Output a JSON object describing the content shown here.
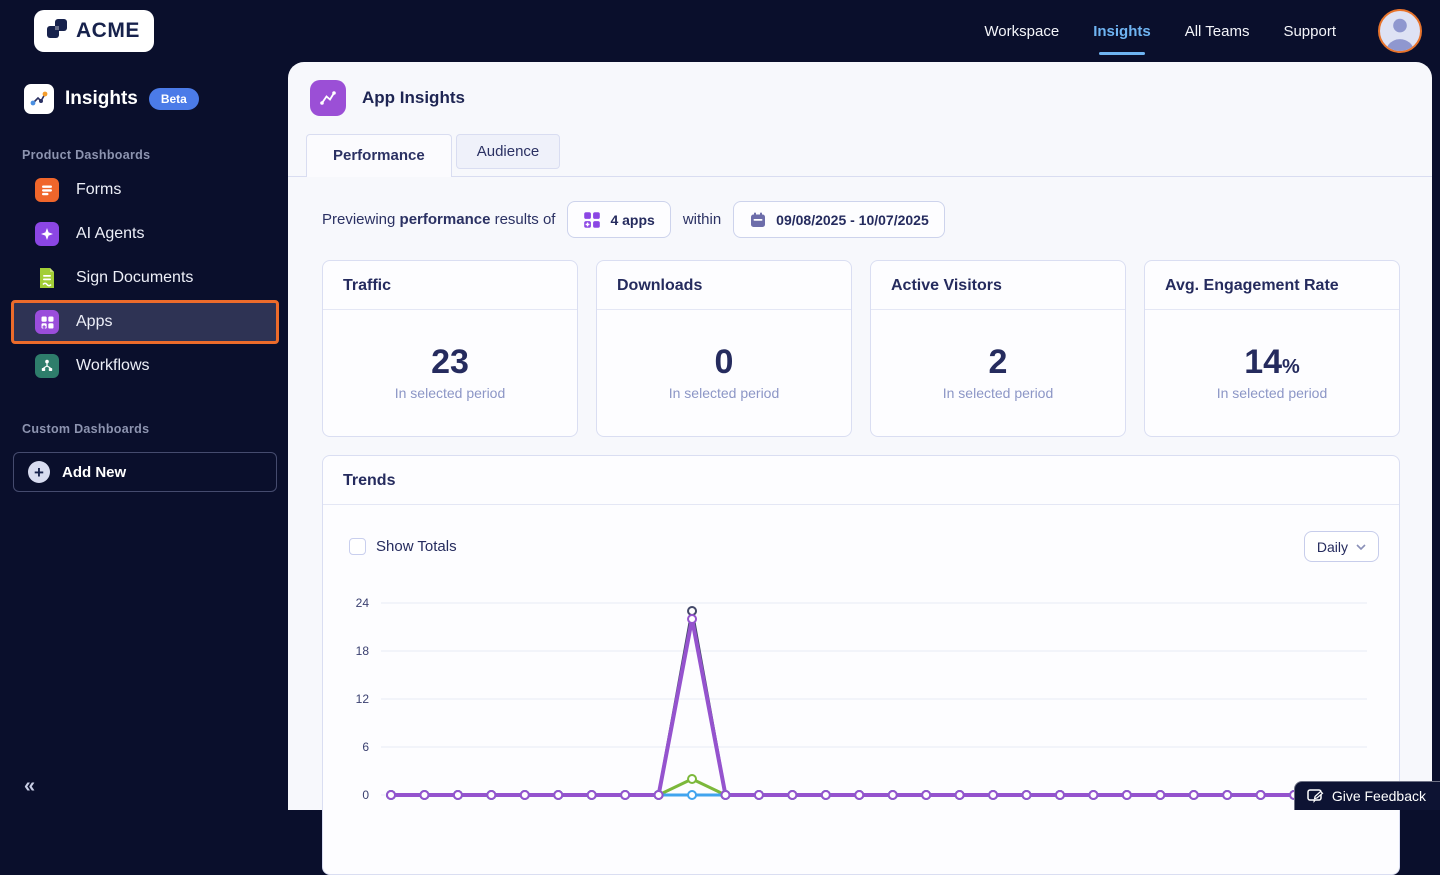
{
  "topbar": {
    "logo_text": "ACME",
    "nav": [
      {
        "label": "Workspace",
        "active": false
      },
      {
        "label": "Insights",
        "active": true
      },
      {
        "label": "All Teams",
        "active": false
      },
      {
        "label": "Support",
        "active": false
      }
    ]
  },
  "sidebar": {
    "title": "Insights",
    "badge": "Beta",
    "section_product": "Product Dashboards",
    "section_custom": "Custom Dashboards",
    "items": [
      {
        "label": "Forms",
        "active": false
      },
      {
        "label": "AI Agents",
        "active": false
      },
      {
        "label": "Sign Documents",
        "active": false
      },
      {
        "label": "Apps",
        "active": true
      },
      {
        "label": "Workflows",
        "active": false
      }
    ],
    "add_new_label": "Add New",
    "collapse_icon": "«"
  },
  "main": {
    "page_title": "App Insights",
    "tabs": [
      {
        "label": "Performance",
        "active": true
      },
      {
        "label": "Audience",
        "active": false
      }
    ],
    "filter": {
      "prefix": "Previewing",
      "bold_word": "performance",
      "suffix": "results of",
      "apps_select_value": "4 apps",
      "within_label": "within",
      "date_range_value": "09/08/2025 - 10/07/2025"
    },
    "stat_cards": [
      {
        "title": "Traffic",
        "value": "23",
        "unit": "",
        "caption": "In selected period"
      },
      {
        "title": "Downloads",
        "value": "0",
        "unit": "",
        "caption": "In selected period"
      },
      {
        "title": "Active Visitors",
        "value": "2",
        "unit": "",
        "caption": "In selected period"
      },
      {
        "title": "Avg. Engagement Rate",
        "value": "14",
        "unit": "%",
        "caption": "In selected period"
      }
    ],
    "trends": {
      "title": "Trends",
      "show_totals_label": "Show Totals",
      "show_totals_checked": false,
      "interval_select_value": "Daily"
    }
  },
  "feedback_button": {
    "label": "Give Feedback"
  },
  "chart_data": {
    "type": "line",
    "x_points": 30,
    "x_labels_visible": false,
    "yticks": [
      0,
      6,
      12,
      18,
      24
    ],
    "ylim": [
      0,
      24
    ],
    "grid": true,
    "note": "30 daily points for 09/08/2025-10/07/2025; all series flat at 0 except a spike on day 10",
    "series": [
      {
        "name": "peak-dark",
        "color": "#434869",
        "values": [
          0,
          0,
          0,
          0,
          0,
          0,
          0,
          0,
          0,
          23,
          0,
          0,
          0,
          0,
          0,
          0,
          0,
          0,
          0,
          0,
          0,
          0,
          0,
          0,
          0,
          0,
          0,
          0,
          0,
          0
        ]
      },
      {
        "name": "green-series",
        "color": "#7CB83B",
        "values": [
          0,
          0,
          0,
          0,
          0,
          0,
          0,
          0,
          0,
          2,
          0,
          0,
          0,
          0,
          0,
          0,
          0,
          0,
          0,
          0,
          0,
          0,
          0,
          0,
          0,
          0,
          0,
          0,
          0,
          0
        ]
      },
      {
        "name": "blue-series",
        "color": "#41A4EE",
        "values": [
          0,
          0,
          0,
          0,
          0,
          0,
          0,
          0,
          0,
          0,
          0,
          0,
          0,
          0,
          0,
          0,
          0,
          0,
          0,
          0,
          0,
          0,
          0,
          0,
          0,
          0,
          0,
          0,
          0,
          0
        ]
      },
      {
        "name": "purple-series",
        "color": "#9553CE",
        "values": [
          0,
          0,
          0,
          0,
          0,
          0,
          0,
          0,
          0,
          22,
          0,
          0,
          0,
          0,
          0,
          0,
          0,
          0,
          0,
          0,
          0,
          0,
          0,
          0,
          0,
          0,
          0,
          0,
          0,
          0
        ]
      }
    ]
  },
  "colors": {
    "background_navy": "#0A0F2C",
    "accent_orange": "#EC6B2B",
    "accent_purple": "#9B4FD6",
    "link_blue": "#6FB4F2",
    "grid_line": "#E8EAF4",
    "text_navy": "#252B5E"
  }
}
